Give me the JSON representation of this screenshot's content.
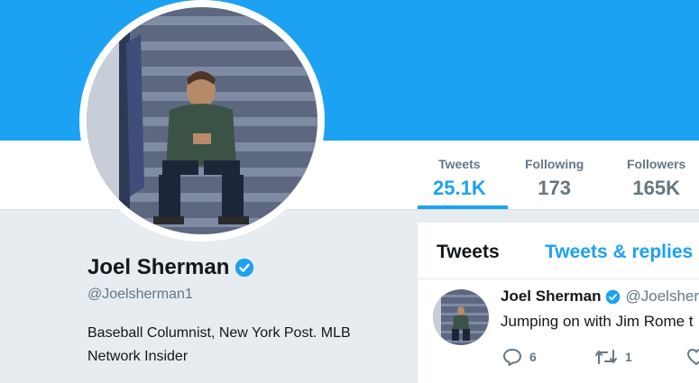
{
  "colors": {
    "brand": "#1da1f2",
    "text_primary": "#14171a",
    "text_secondary": "#657786",
    "background": "#e6ecf0"
  },
  "stats": [
    {
      "label": "Tweets",
      "value": "25.1K",
      "active": true
    },
    {
      "label": "Following",
      "value": "173",
      "active": false
    },
    {
      "label": "Followers",
      "value": "165K",
      "active": false
    }
  ],
  "profile": {
    "name": "Joel Sherman",
    "handle": "@Joelsherman1",
    "bio": "Baseball Columnist, New York Post. MLB Network Insider",
    "verified_icon": "verified-badge-icon",
    "avatar_icon": "profile-photo"
  },
  "timeline": {
    "tabs": [
      "Tweets",
      "Tweets & replies"
    ],
    "tweet": {
      "name": "Joel Sherman",
      "handle": "@Joelsher",
      "text": "Jumping on with Jim Rome t",
      "actions": [
        {
          "icon": "reply-icon",
          "count": "6"
        },
        {
          "icon": "retweet-icon",
          "count": "1"
        },
        {
          "icon": "like-icon",
          "count": ""
        }
      ]
    }
  }
}
